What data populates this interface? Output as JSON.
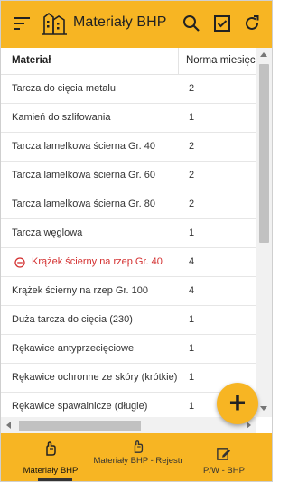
{
  "app": {
    "title": "Materiały BHP",
    "accent": "#f7b523"
  },
  "header": {
    "menu_icon": "menu-icon",
    "logo_icon": "buildings-logo-icon",
    "actions": [
      "search-icon",
      "checkbox-icon",
      "refresh-icon"
    ]
  },
  "table": {
    "columns": [
      "Materiał",
      "Norma miesięc"
    ],
    "rows": [
      {
        "name": "Tarcza do cięcia metalu",
        "norm": "2"
      },
      {
        "name": "Kamień do szlifowania",
        "norm": "1"
      },
      {
        "name": "Tarcza lamelkowa ścierna Gr. 40",
        "norm": "2"
      },
      {
        "name": "Tarcza lamelkowa ścierna Gr. 60",
        "norm": "2"
      },
      {
        "name": "Tarcza lamelkowa ścierna Gr. 80",
        "norm": "2"
      },
      {
        "name": "Tarcza węglowa",
        "norm": "1"
      },
      {
        "name": "Krążek ścierny na rzep Gr. 40",
        "norm": "4",
        "highlight": true,
        "status_color": "#d32f2f"
      },
      {
        "name": "Krążek ścierny na rzep Gr. 100",
        "norm": "4"
      },
      {
        "name": "Duża tarcza do cięcia (230)",
        "norm": "1"
      },
      {
        "name": "Rękawice antyprzecięciowe",
        "norm": "1"
      },
      {
        "name": "Rękawice ochronne ze skóry (krótkie)",
        "norm": "1"
      },
      {
        "name": "Rękawice spawalnicze (długie)",
        "norm": "1"
      }
    ]
  },
  "fab": {
    "label": "+",
    "icon": "add-icon"
  },
  "bottom_nav": [
    {
      "label": "Materiały BHP",
      "icon": "hand-icon",
      "active": true
    },
    {
      "label": "Materiały BHP - Rejestr",
      "icon": "hand-icon",
      "active": false
    },
    {
      "label": "P/W - BHP",
      "icon": "edit-icon",
      "active": false
    }
  ]
}
